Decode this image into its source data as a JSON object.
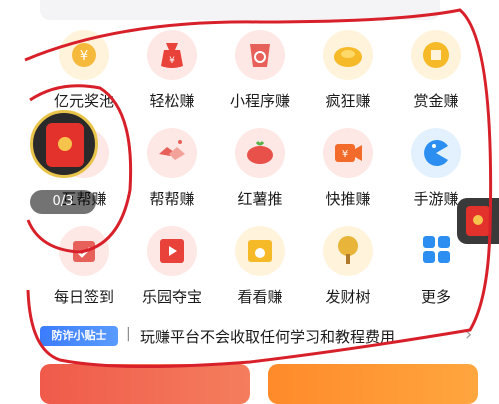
{
  "grid": {
    "row1": [
      {
        "label": "亿元奖池",
        "icon": "yuan-coin-icon"
      },
      {
        "label": "轻松赚",
        "icon": "money-bag-icon"
      },
      {
        "label": "小程序赚",
        "icon": "mini-program-cup-icon"
      },
      {
        "label": "疯狂赚",
        "icon": "gold-ingot-icon"
      },
      {
        "label": "赏金赚",
        "icon": "gold-coin-icon"
      }
    ],
    "row2": [
      {
        "label": "互帮赚",
        "icon": "hidden-icon"
      },
      {
        "label": "帮帮赚",
        "icon": "handshake-icon"
      },
      {
        "label": "红薯推",
        "icon": "sweet-potato-icon"
      },
      {
        "label": "快推赚",
        "icon": "video-yuan-icon"
      },
      {
        "label": "手游赚",
        "icon": "pacman-game-icon"
      }
    ],
    "row3": [
      {
        "label": "每日签到",
        "icon": "calendar-check-icon"
      },
      {
        "label": "乐园夺宝",
        "icon": "play-screen-icon"
      },
      {
        "label": "看看赚",
        "icon": "envelope-play-icon"
      },
      {
        "label": "发财树",
        "icon": "money-tree-icon"
      },
      {
        "label": "更多",
        "icon": "apps-grid-icon"
      }
    ]
  },
  "tip": {
    "badge": "防诈小贴士",
    "separator": "|",
    "text": "玩赚平台不会收取任何学习和教程费用",
    "arrow": "›"
  },
  "floating": {
    "counter": "0/3"
  },
  "colors": {
    "annotation_red": "#d8202a",
    "icon_bg_red": "#fde8e6",
    "icon_bg_yellow": "#fff3dc",
    "icon_bg_blue": "#e3f1ff"
  }
}
